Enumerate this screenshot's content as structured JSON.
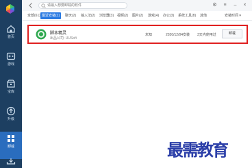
{
  "sidebar": {
    "items": [
      {
        "label": "首页",
        "icon": "home-icon",
        "active": false
      },
      {
        "label": "游戏",
        "icon": "game-icon",
        "active": false
      },
      {
        "label": "宝库",
        "icon": "treasure-icon",
        "active": false
      },
      {
        "label": "升级",
        "icon": "upgrade-icon",
        "active": false
      },
      {
        "label": "卸载",
        "icon": "uninstall-icon",
        "active": true
      }
    ]
  },
  "search": {
    "placeholder": "请输入想要卸载的软件"
  },
  "tabs": [
    {
      "label": "全部(61)",
      "active": false
    },
    {
      "label": "最近安装(1)",
      "active": true
    },
    {
      "label": "聊天(2)",
      "active": false
    },
    {
      "label": "输入法(2)",
      "active": false
    },
    {
      "label": "浏览器(3)",
      "active": false
    },
    {
      "label": "视频(2)",
      "active": false
    },
    {
      "label": "图片(2)",
      "active": false
    },
    {
      "label": "游戏(4)",
      "active": false
    },
    {
      "label": "办公(3)",
      "active": false
    },
    {
      "label": "系统工具(8)",
      "active": false
    },
    {
      "label": "其他",
      "active": false
    }
  ],
  "sort": {
    "label": "安装时间"
  },
  "app": {
    "name": "脚本精灵",
    "publisher": "出品公司: UUSoft",
    "size": "未知",
    "install_date": "2020/12/04安装",
    "usage": "3天内使用过",
    "uninstall_label": "卸载"
  },
  "watermark": "最需教育",
  "colors": {
    "sidebar_bg": "#1d3f61",
    "accent": "#2a7ae2",
    "highlight_border": "#e02020",
    "watermark": "#2b3ea8"
  }
}
